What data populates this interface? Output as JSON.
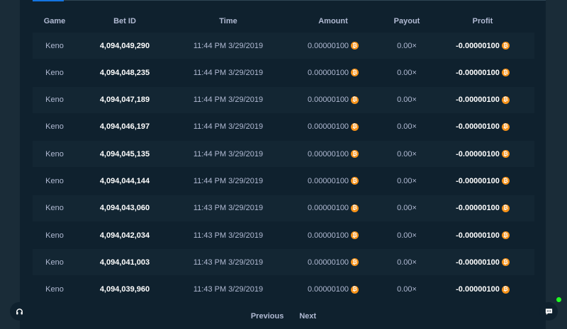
{
  "table": {
    "headers": {
      "game": "Game",
      "bet_id": "Bet ID",
      "time": "Time",
      "amount": "Amount",
      "payout": "Payout",
      "profit": "Profit"
    },
    "rows": [
      {
        "game": "Keno",
        "bet_id": "4,094,049,290",
        "time": "11:44 PM 3/29/2019",
        "amount": "0.00000100",
        "payout": "0.00×",
        "profit": "-0.00000100"
      },
      {
        "game": "Keno",
        "bet_id": "4,094,048,235",
        "time": "11:44 PM 3/29/2019",
        "amount": "0.00000100",
        "payout": "0.00×",
        "profit": "-0.00000100"
      },
      {
        "game": "Keno",
        "bet_id": "4,094,047,189",
        "time": "11:44 PM 3/29/2019",
        "amount": "0.00000100",
        "payout": "0.00×",
        "profit": "-0.00000100"
      },
      {
        "game": "Keno",
        "bet_id": "4,094,046,197",
        "time": "11:44 PM 3/29/2019",
        "amount": "0.00000100",
        "payout": "0.00×",
        "profit": "-0.00000100"
      },
      {
        "game": "Keno",
        "bet_id": "4,094,045,135",
        "time": "11:44 PM 3/29/2019",
        "amount": "0.00000100",
        "payout": "0.00×",
        "profit": "-0.00000100"
      },
      {
        "game": "Keno",
        "bet_id": "4,094,044,144",
        "time": "11:44 PM 3/29/2019",
        "amount": "0.00000100",
        "payout": "0.00×",
        "profit": "-0.00000100"
      },
      {
        "game": "Keno",
        "bet_id": "4,094,043,060",
        "time": "11:43 PM 3/29/2019",
        "amount": "0.00000100",
        "payout": "0.00×",
        "profit": "-0.00000100"
      },
      {
        "game": "Keno",
        "bet_id": "4,094,042,034",
        "time": "11:43 PM 3/29/2019",
        "amount": "0.00000100",
        "payout": "0.00×",
        "profit": "-0.00000100"
      },
      {
        "game": "Keno",
        "bet_id": "4,094,041,003",
        "time": "11:43 PM 3/29/2019",
        "amount": "0.00000100",
        "payout": "0.00×",
        "profit": "-0.00000100"
      },
      {
        "game": "Keno",
        "bet_id": "4,094,039,960",
        "time": "11:43 PM 3/29/2019",
        "amount": "0.00000100",
        "payout": "0.00×",
        "profit": "-0.00000100"
      }
    ]
  },
  "currency_icon": {
    "name": "bitcoin-icon",
    "glyph": "₿",
    "color": "#f7931a"
  },
  "pagination": {
    "previous": "Previous",
    "next": "Next"
  },
  "colors": {
    "accent": "#1475e1",
    "online": "#1fff20"
  }
}
